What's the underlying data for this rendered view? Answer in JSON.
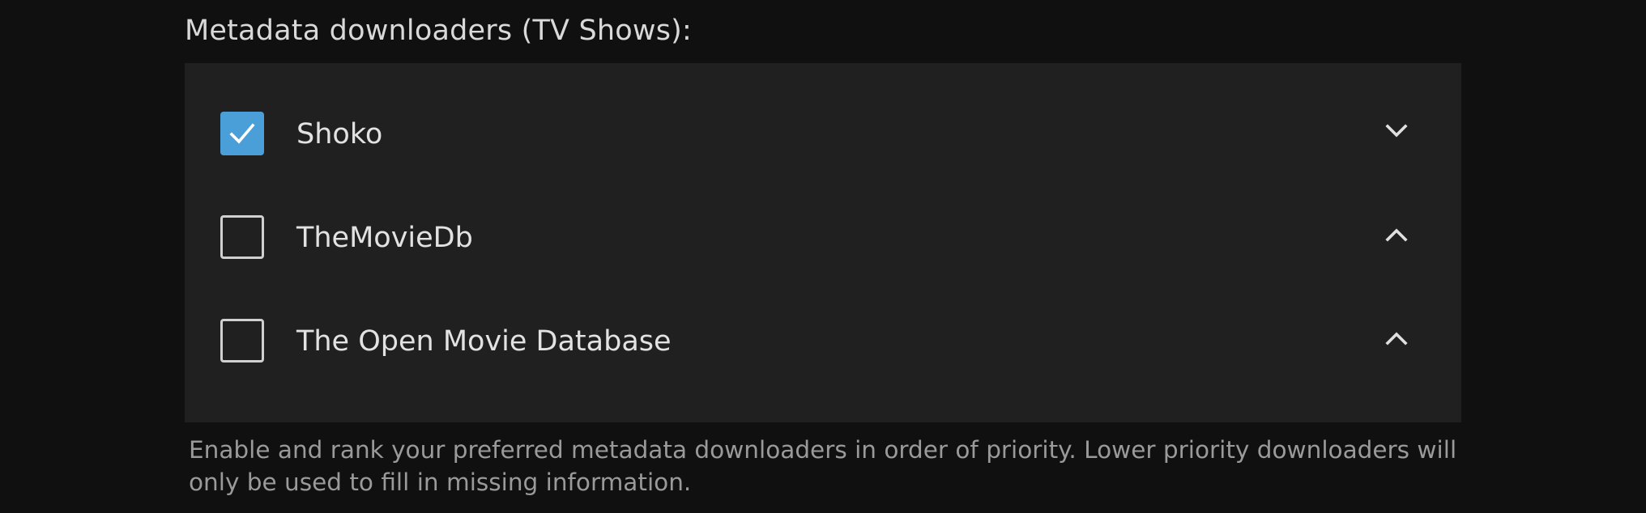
{
  "section": {
    "heading": "Metadata downloaders (TV Shows):",
    "help_text": "Enable and rank your preferred metadata downloaders in order of priority. Lower priority downloaders will only be used to fill in missing information."
  },
  "downloaders": [
    {
      "label": "Shoko",
      "checked": true,
      "chevron": "chevron-down-icon"
    },
    {
      "label": "TheMovieDb",
      "checked": false,
      "chevron": "chevron-up-icon"
    },
    {
      "label": "The Open Movie Database",
      "checked": false,
      "chevron": "chevron-up-icon"
    }
  ],
  "colors": {
    "page_background": "#101010",
    "list_background": "#202020",
    "checkbox_checked": "#4a9fd8",
    "text_primary": "#e2e2e2",
    "text_secondary": "#9a9a9a"
  }
}
